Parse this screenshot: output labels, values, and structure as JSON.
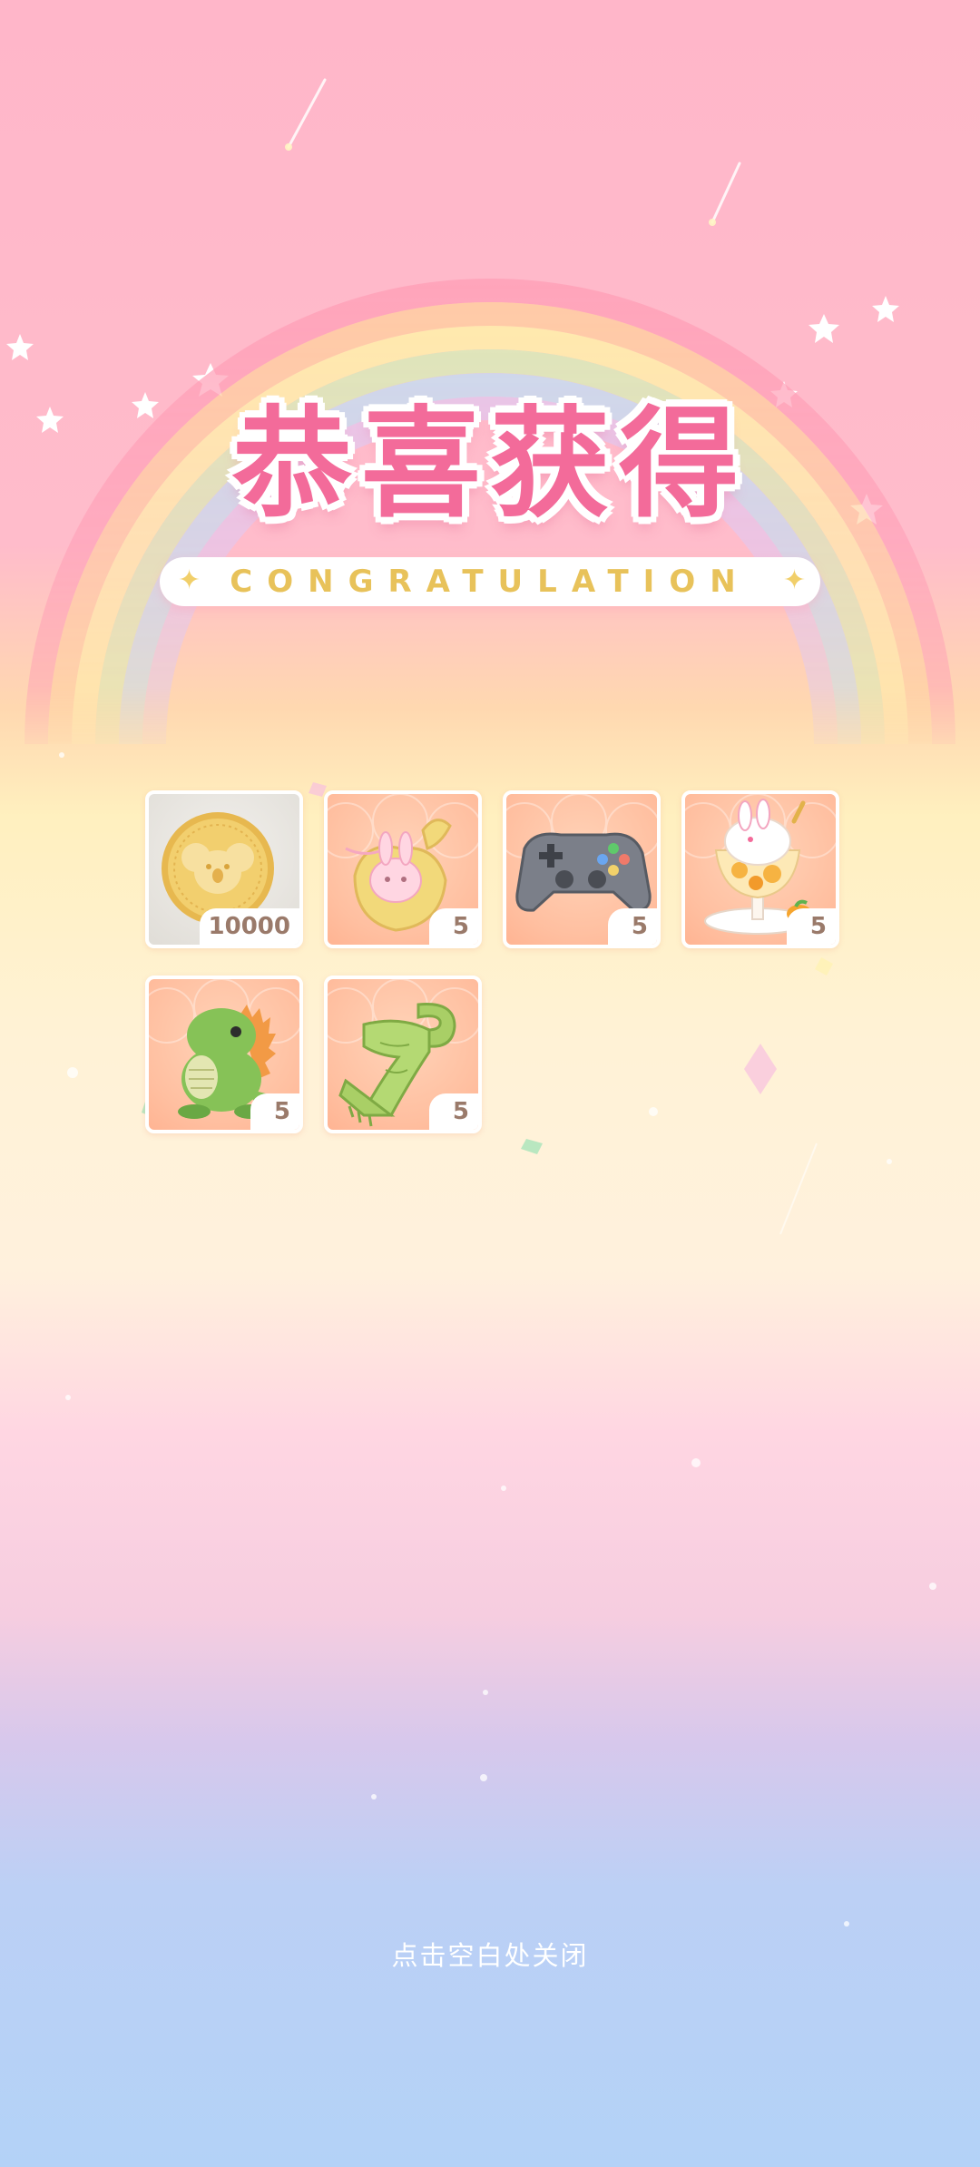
{
  "title_cn": "恭喜获得",
  "title_en": "CONGRATULATION",
  "sparkle_glyph": "✦",
  "rewards": [
    {
      "icon": "koala-coin-icon",
      "quantity": "10000"
    },
    {
      "icon": "bunny-pouch-icon",
      "quantity": "5"
    },
    {
      "icon": "gamepad-icon",
      "quantity": "5"
    },
    {
      "icon": "parfait-icon",
      "quantity": "5"
    },
    {
      "icon": "dinosaur-plush-icon",
      "quantity": "5"
    },
    {
      "icon": "green-scarf-icon",
      "quantity": "5"
    }
  ],
  "close_hint": "点击空白处关闭",
  "colors": {
    "title": "#f36b9a",
    "subtitle": "#e8c25a",
    "quantity_text": "#9a7a6a"
  }
}
